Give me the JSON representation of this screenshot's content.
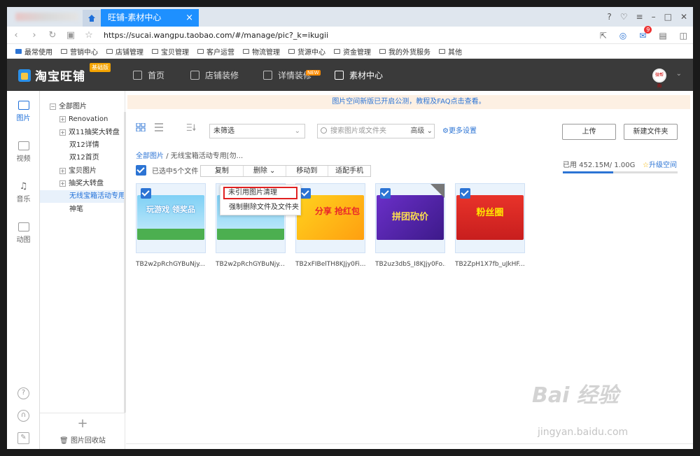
{
  "browser": {
    "tab_title": "旺铺-素材中心",
    "tab_close": "×",
    "url": "https://sucai.wangpu.taobao.com/#/manage/pic?_k=ikugii",
    "mail_badge": "9",
    "bookmarks": [
      "最常使用",
      "营销中心",
      "店铺管理",
      "宝贝管理",
      "客户运营",
      "物流管理",
      "货源中心",
      "资金管理",
      "我的外货服务",
      "其他"
    ]
  },
  "app": {
    "logo": "淘宝旺铺",
    "edition": "基础版",
    "nav": [
      "首页",
      "店铺装修",
      "详情装修",
      "素材中心"
    ],
    "new_tag": "NEW",
    "avatar_text": "微帮购"
  },
  "rail": [
    "图片",
    "视频",
    "音乐",
    "动图"
  ],
  "tree": {
    "items": [
      "全部图片",
      "Renovation",
      "双11抽奖大转盘",
      "双12详情",
      "双12首页",
      "宝贝图片",
      "抽奖大转盘",
      "无线宝箱活动专用[勿",
      "神笔"
    ],
    "add": "+",
    "recycle": "图片回收站"
  },
  "main": {
    "notice": "图片空间新版已开启公测，教程及FAQ点击查看。",
    "filter": "未筛选",
    "search_placeholder": "搜索图片或文件夹",
    "advanced": "高级",
    "more_settings": "更多设置",
    "upload": "上传",
    "new_folder": "新建文件夹",
    "crumb_root": "全部图片",
    "crumb_sep": "/",
    "crumb_current": "无线宝箱活动专用[勿...",
    "selected": "已选中5个文件",
    "actions": [
      "复制",
      "删除",
      "移动到",
      "适配手机"
    ],
    "storage_used": "已用 452.15M/ 1.00G",
    "storage_fraction": 0.44,
    "upgrade": "升级空间",
    "context_menu": [
      "未引用图片清理",
      "强制删除文件及文件夹"
    ],
    "thumbs": [
      {
        "name": "TB2w2pRchGYBuNjy...",
        "text": "玩游戏 领奖品"
      },
      {
        "name": "TB2w2pRchGYBuNjy...",
        "text": ""
      },
      {
        "name": "TB2xFIBelTH8KJjy0Fi...",
        "text": "分享 抢红包"
      },
      {
        "name": "TB2uz3dbS_I8KJjy0Fo...",
        "text": "拼团砍价"
      },
      {
        "name": "TB2ZpH1X7fb_uJkHF...",
        "text": "粉丝圈"
      }
    ]
  },
  "watermark": {
    "logo": "Bai 经验",
    "url": "jingyan.baidu.com"
  }
}
